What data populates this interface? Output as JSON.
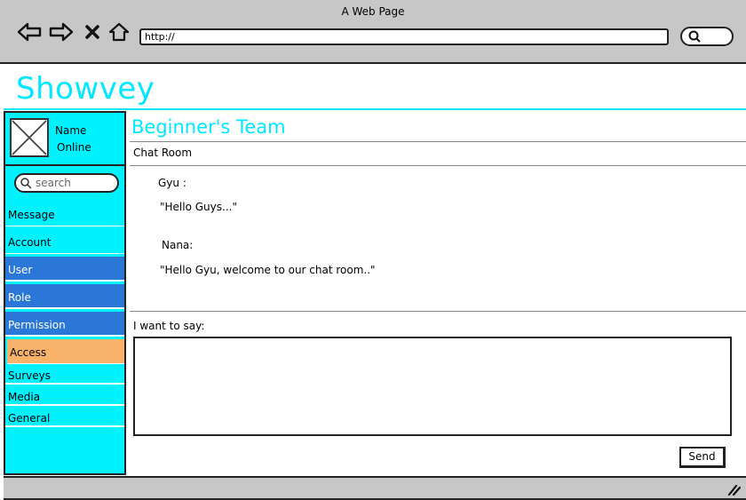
{
  "window": {
    "title": "A Web Page"
  },
  "browser": {
    "url": "http://"
  },
  "brand": {
    "name": "Showvey"
  },
  "profile": {
    "name": "Name",
    "status": "Online"
  },
  "sidebar": {
    "search_placeholder": "search",
    "items": [
      {
        "label": "Message",
        "style": "cyan"
      },
      {
        "label": "Account",
        "style": "cyan"
      },
      {
        "label": "User",
        "style": "blue"
      },
      {
        "label": "Role",
        "style": "blue"
      },
      {
        "label": "Permission",
        "style": "blue"
      },
      {
        "label": "Access",
        "style": "orange"
      },
      {
        "label": "Surveys",
        "style": "sub"
      },
      {
        "label": "Media",
        "style": "sub"
      },
      {
        "label": "General",
        "style": "sub"
      }
    ]
  },
  "main": {
    "team_title": "Beginner's Team",
    "room_label": "Chat Room",
    "messages": [
      {
        "sender": "Gyu :",
        "text": "\"Hello Guys...\""
      },
      {
        "sender": "Nana:",
        "text": "\"Hello Gyu, welcome to our chat room..\""
      }
    ],
    "compose_label": "I want to say:",
    "send_label": "Send"
  },
  "colors": {
    "accent": "#00e8ff",
    "sidebar": "#00f2ff",
    "selected": "#2a77d8",
    "highlight": "#f8b26a"
  }
}
